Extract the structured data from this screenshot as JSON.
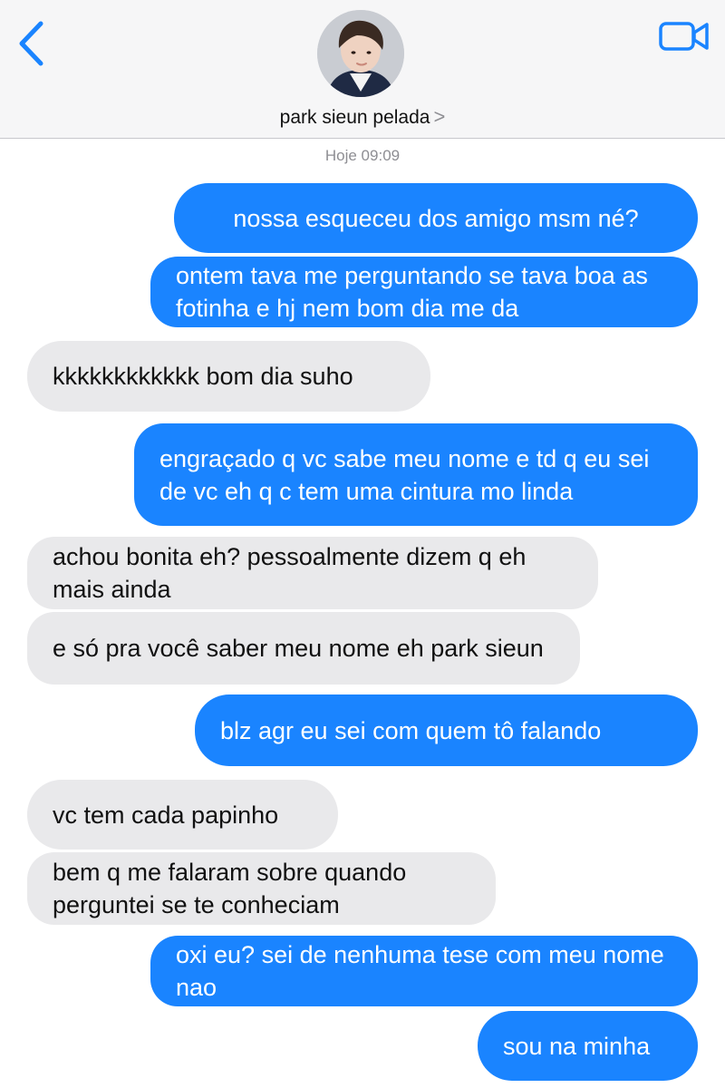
{
  "header": {
    "back_icon": "chevron-left-icon",
    "video_icon": "video-camera-icon",
    "avatar_icon": "profile-photo",
    "contact_name": "park sieun pelada",
    "contact_chevron": ">",
    "accent_color": "#1a84ff"
  },
  "conversation": {
    "timestamp": "Hoje 09:09",
    "messages": [
      {
        "direction": "sent",
        "text": "nossa esqueceu dos amigo msm né?"
      },
      {
        "direction": "sent",
        "text": "ontem tava me perguntando se tava boa as fotinha e hj nem bom dia me da"
      },
      {
        "direction": "received",
        "text": "kkkkkkkkkkkk bom dia suho"
      },
      {
        "direction": "sent",
        "text": "engraçado q vc sabe meu nome e td q eu sei de vc eh q c tem uma cintura mo linda"
      },
      {
        "direction": "received",
        "text": "achou bonita eh? pessoalmente dizem q eh mais ainda"
      },
      {
        "direction": "received",
        "text": "e só pra você saber meu nome eh park sieun"
      },
      {
        "direction": "sent",
        "text": "blz agr eu sei com quem tô falando"
      },
      {
        "direction": "received",
        "text": "vc tem cada papinho"
      },
      {
        "direction": "received",
        "text": "bem q me falaram sobre quando perguntei se te conheciam"
      },
      {
        "direction": "sent",
        "text": "oxi eu? sei de nenhuma tese com meu nome nao"
      },
      {
        "direction": "sent",
        "text": "sou na minha"
      }
    ]
  },
  "colors": {
    "sent_bubble": "#1a84ff",
    "received_bubble": "#e9e9eb"
  }
}
